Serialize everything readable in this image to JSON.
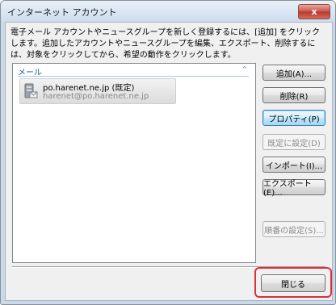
{
  "window": {
    "title": "インターネット アカウント",
    "close_glyph": "x"
  },
  "description": "電子メール アカウントやニュースグループを新しく登録するには、[追加] をクリックします。追加したアカウントやニュースグループを編集、エクスポート、削除するには、対象をクリックしてから、希望の動作をクリックします。",
  "list": {
    "header": "メール",
    "sort_glyph": "^",
    "items": [
      {
        "name": "po.harenet.ne.jp (既定)",
        "email": "harenet@po.harenet.ne.jp",
        "icon": "mail-server-icon"
      }
    ]
  },
  "buttons": {
    "add": "追加(A)...",
    "remove": "削除(R)",
    "properties": "プロパティ(P)",
    "set_default": "既定に設定(D)",
    "import": "インポート(I)...",
    "export": "エクスポート(E)...",
    "order": "順番の設定(S)...",
    "close": "閉じる"
  },
  "colors": {
    "highlight": "#d9303b",
    "header_text": "#1e4f99"
  }
}
